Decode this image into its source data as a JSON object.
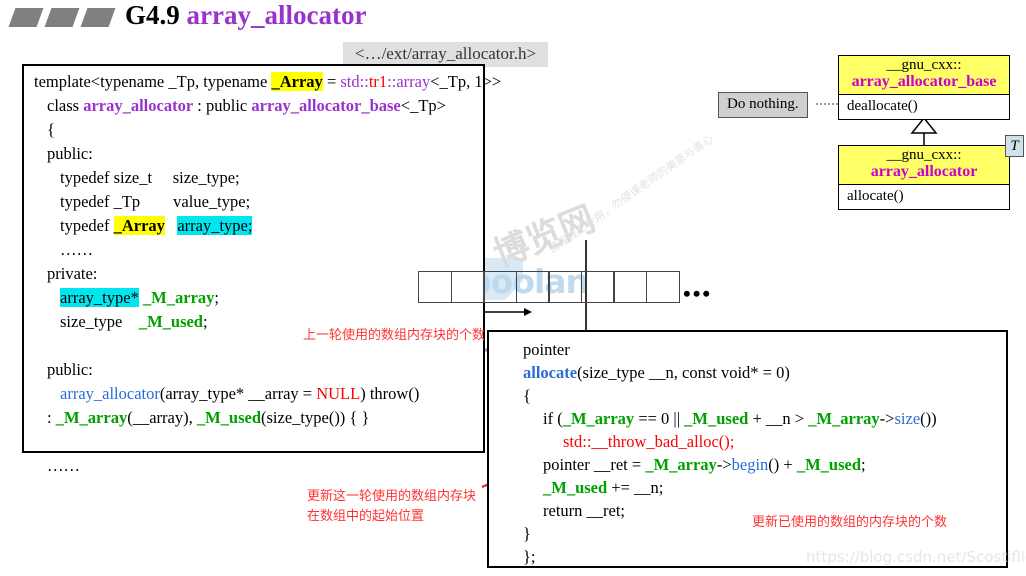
{
  "header": {
    "title_prefix": "G4.9 ",
    "title_name": "array_allocator",
    "decor_count": 3
  },
  "file_tab": {
    "label": "<…/ext/array_allocator.h>"
  },
  "code_box": {
    "lines": [
      {
        "indent": 0,
        "segments": [
          {
            "t": "template<typename _Tp, typename ",
            "c": "plain"
          },
          {
            "t": "_Array",
            "c": "bold-hl-yellow"
          },
          {
            "t": " = ",
            "c": "plain"
          },
          {
            "t": "std::",
            "c": "purple"
          },
          {
            "t": "tr1",
            "c": "red"
          },
          {
            "t": "::",
            "c": "purple"
          },
          {
            "t": "array",
            "c": "purple"
          },
          {
            "t": "<_Tp, 1>>",
            "c": "plain"
          }
        ]
      },
      {
        "indent": 1,
        "segments": [
          {
            "t": "class ",
            "c": "plain"
          },
          {
            "t": "array_allocator",
            "c": "purple-bold"
          },
          {
            "t": " : public ",
            "c": "plain"
          },
          {
            "t": "array_allocator_base",
            "c": "purple-bold"
          },
          {
            "t": "<_Tp>",
            "c": "plain"
          }
        ]
      },
      {
        "indent": 1,
        "segments": [
          {
            "t": "{",
            "c": "plain"
          }
        ]
      },
      {
        "indent": 1,
        "segments": [
          {
            "t": "public:",
            "c": "plain"
          }
        ]
      },
      {
        "indent": 2,
        "segments": [
          {
            "t": "typedef size_t     size_type;",
            "c": "plain"
          }
        ]
      },
      {
        "indent": 2,
        "segments": [
          {
            "t": "typedef _Tp        value_type;",
            "c": "plain"
          }
        ]
      },
      {
        "indent": 2,
        "segments": [
          {
            "t": "typedef ",
            "c": "plain"
          },
          {
            "t": "_Array",
            "c": "bold-hl-yellow"
          },
          {
            "t": "   ",
            "c": "plain"
          },
          {
            "t": "array_type;",
            "c": "hl-cyan"
          }
        ]
      },
      {
        "indent": 2,
        "segments": [
          {
            "t": "……",
            "c": "plain"
          }
        ]
      },
      {
        "indent": 1,
        "segments": [
          {
            "t": "private:",
            "c": "plain"
          }
        ]
      },
      {
        "indent": 2,
        "segments": [
          {
            "t": "array_type*",
            "c": "hl-cyan"
          },
          {
            "t": " ",
            "c": "plain"
          },
          {
            "t": "_M_array",
            "c": "green-bold"
          },
          {
            "t": ";",
            "c": "plain"
          }
        ]
      },
      {
        "indent": 2,
        "segments": [
          {
            "t": "size_type    ",
            "c": "plain"
          },
          {
            "t": "_M_used",
            "c": "green-bold"
          },
          {
            "t": ";",
            "c": "plain"
          }
        ]
      },
      {
        "indent": 0,
        "segments": [
          {
            "t": " ",
            "c": "plain"
          }
        ]
      },
      {
        "indent": 1,
        "segments": [
          {
            "t": "public:",
            "c": "plain"
          }
        ]
      },
      {
        "indent": 2,
        "segments": [
          {
            "t": "array_allocator",
            "c": "blue"
          },
          {
            "t": "(array_type* __array = ",
            "c": "plain"
          },
          {
            "t": "NULL",
            "c": "red"
          },
          {
            "t": ") throw()",
            "c": "plain"
          }
        ]
      },
      {
        "indent": 1,
        "segments": [
          {
            "t": ": ",
            "c": "plain"
          },
          {
            "t": "_M_array",
            "c": "green-bold"
          },
          {
            "t": "(__array), ",
            "c": "plain"
          },
          {
            "t": "_M_used",
            "c": "green-bold"
          },
          {
            "t": "(size_type()) { }",
            "c": "plain"
          }
        ]
      },
      {
        "indent": 0,
        "segments": [
          {
            "t": " ",
            "c": "plain"
          }
        ]
      },
      {
        "indent": 1,
        "segments": [
          {
            "t": "……",
            "c": "plain"
          }
        ]
      }
    ]
  },
  "alloc_box": {
    "lines": [
      {
        "indent": 1,
        "segments": [
          {
            "t": "pointer",
            "c": "plain"
          }
        ]
      },
      {
        "indent": 1,
        "segments": [
          {
            "t": "allocate",
            "c": "blue-bold"
          },
          {
            "t": "(size_type __n, const void* = 0)",
            "c": "plain"
          }
        ]
      },
      {
        "indent": 1,
        "segments": [
          {
            "t": "{",
            "c": "plain"
          }
        ]
      },
      {
        "indent": 2,
        "segments": [
          {
            "t": "if (",
            "c": "plain"
          },
          {
            "t": "_M_array",
            "c": "green-bold"
          },
          {
            "t": " == 0 || ",
            "c": "plain"
          },
          {
            "t": "_M_used",
            "c": "green-bold"
          },
          {
            "t": " + __n > ",
            "c": "plain"
          },
          {
            "t": "_M_array",
            "c": "green-bold"
          },
          {
            "t": "->",
            "c": "plain"
          },
          {
            "t": "size",
            "c": "blue"
          },
          {
            "t": "())",
            "c": "plain"
          }
        ]
      },
      {
        "indent": 3,
        "segments": [
          {
            "t": "std::__throw_bad_alloc();",
            "c": "red"
          }
        ]
      },
      {
        "indent": 2,
        "segments": [
          {
            "t": "pointer __ret = ",
            "c": "plain"
          },
          {
            "t": "_M_array",
            "c": "green-bold"
          },
          {
            "t": "->",
            "c": "plain"
          },
          {
            "t": "begin",
            "c": "blue"
          },
          {
            "t": "() + ",
            "c": "plain"
          },
          {
            "t": "_M_used",
            "c": "green-bold"
          },
          {
            "t": ";",
            "c": "plain"
          }
        ]
      },
      {
        "indent": 2,
        "segments": [
          {
            "t": "_M_used",
            "c": "green-bold"
          },
          {
            "t": " += __n;",
            "c": "plain"
          }
        ]
      },
      {
        "indent": 2,
        "segments": [
          {
            "t": "return __ret;",
            "c": "plain"
          }
        ]
      },
      {
        "indent": 1,
        "segments": [
          {
            "t": "}",
            "c": "plain"
          }
        ]
      },
      {
        "indent": 1,
        "segments": [
          {
            "t": "};",
            "c": "plain"
          }
        ]
      }
    ]
  },
  "uml": {
    "base": {
      "namespace": "__gnu_cxx::",
      "class_name": "array_allocator_base",
      "operation": "deallocate()"
    },
    "derived": {
      "namespace": "__gnu_cxx::",
      "class_name": "array_allocator",
      "operation": "allocate()"
    },
    "note": "Do nothing.",
    "badge": "T"
  },
  "memory": {
    "cell_count": 8,
    "ellipsis": "•••"
  },
  "annotations": {
    "used_count": "上一轮使用的数组内存块的个数",
    "ret_start_line1": "更新这一轮使用的数组内存块",
    "ret_start_line2": "在数组中的起始位置",
    "update_used": "更新已使用的数组的内存块的个数"
  },
  "watermarks": {
    "boolan": "boolan",
    "cn_big": "博览网",
    "cn_small": "课程线上专用，勿侵课老师的美意与善心",
    "url": "https://blog.csdn.net/Scostiflle",
    "cn_diag": "线上课程专用"
  },
  "colors": {
    "purple": "#9933cc",
    "green": "#00a000",
    "blue": "#2a6bd8",
    "red": "#ff0000",
    "highlight_yellow": "#ffff00",
    "highlight_cyan": "#00e5ee",
    "uml_header": "#ffff66",
    "uml_class_name": "#cc00cc",
    "note_bg": "#d0d0d0",
    "tab_bg": "#e0e0e0",
    "decor_gray": "#808080"
  }
}
